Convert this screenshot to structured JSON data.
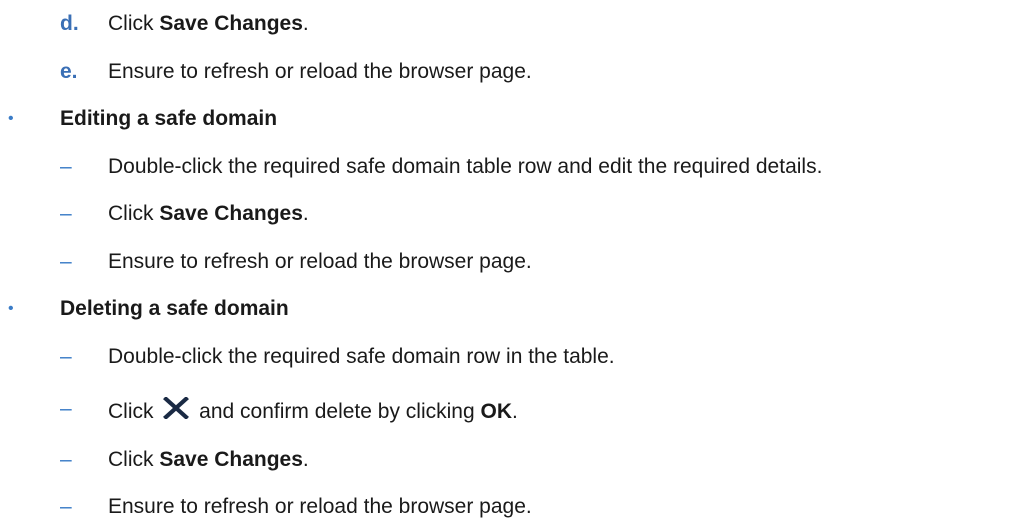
{
  "steps_d": {
    "marker": "d.",
    "pre": "Click ",
    "bold": "Save Changes",
    "post": "."
  },
  "steps_e": {
    "marker": "e.",
    "text": "Ensure to refresh or reload the browser page."
  },
  "editing": {
    "bullet": "•",
    "heading": "Editing a safe domain",
    "items": [
      {
        "dash": "–",
        "text": "Double-click the required safe domain table row and edit the required details."
      },
      {
        "dash": "–",
        "pre": "Click ",
        "bold": "Save Changes",
        "post": "."
      },
      {
        "dash": "–",
        "text": "Ensure to refresh or reload the browser page."
      }
    ]
  },
  "deleting": {
    "bullet": "•",
    "heading": "Deleting a safe domain",
    "items": [
      {
        "dash": "–",
        "text": "Double-click the required safe domain row in the table."
      },
      {
        "dash": "–",
        "pre": "Click ",
        "icon": "close-x-icon",
        "mid": " and confirm delete by clicking ",
        "bold": "OK",
        "post": "."
      },
      {
        "dash": "–",
        "pre": "Click ",
        "bold": "Save Changes",
        "post": "."
      },
      {
        "dash": "–",
        "text": "Ensure to refresh or reload the browser page."
      }
    ]
  }
}
